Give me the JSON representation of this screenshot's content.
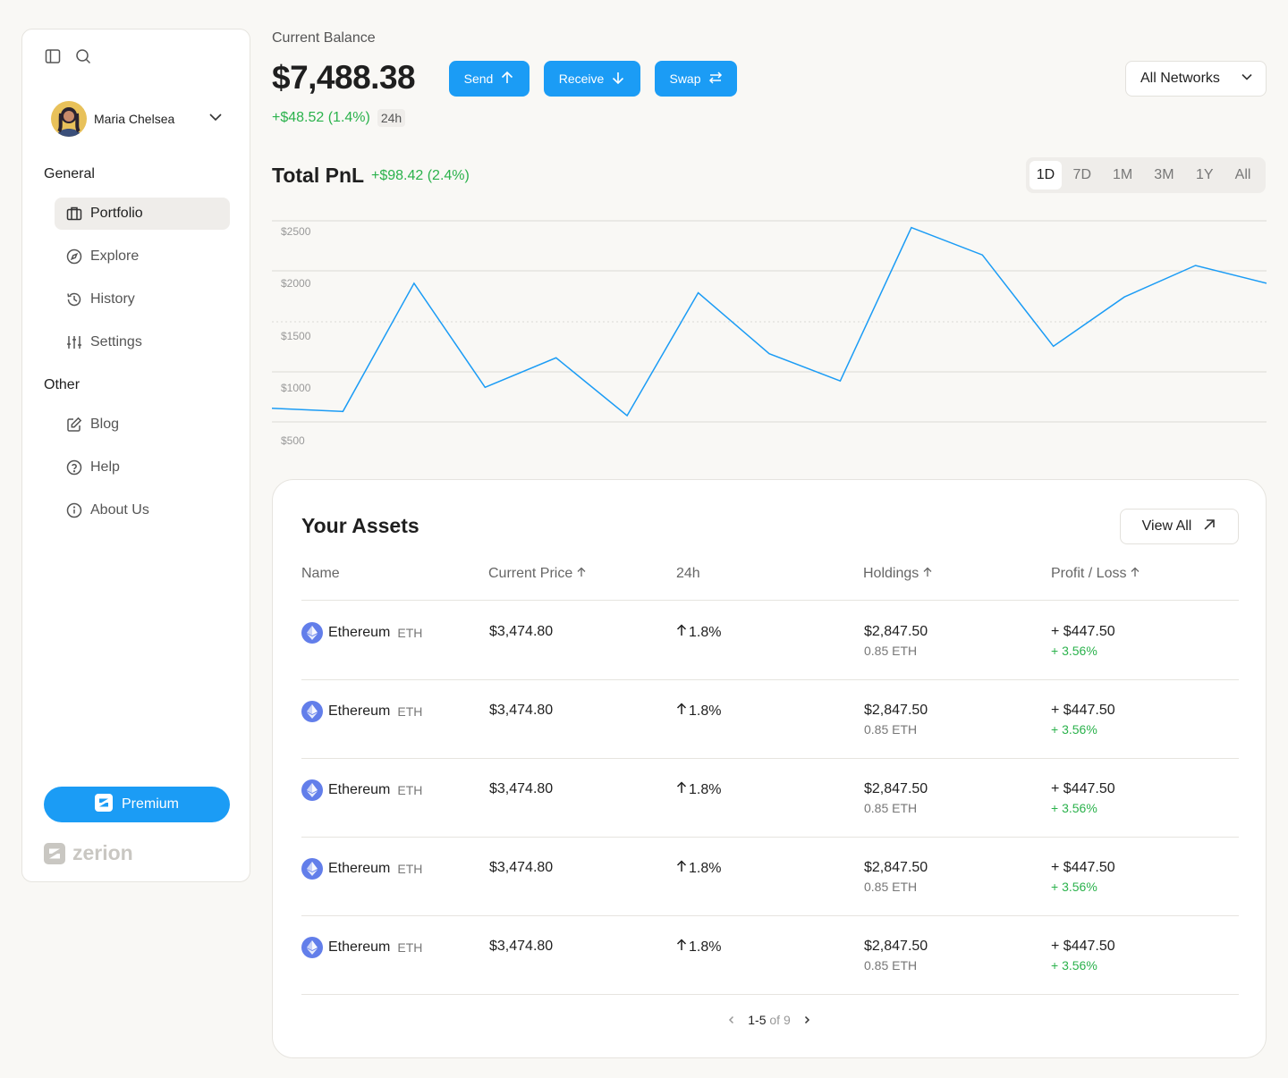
{
  "user": {
    "name": "Maria Chelsea"
  },
  "nav": {
    "general_label": "General",
    "other_label": "Other",
    "general": [
      {
        "label": "Portfolio",
        "icon": "briefcase-icon",
        "active": true
      },
      {
        "label": "Explore",
        "icon": "compass-icon"
      },
      {
        "label": "History",
        "icon": "history-icon"
      },
      {
        "label": "Settings",
        "icon": "sliders-icon"
      }
    ],
    "other": [
      {
        "label": "Blog",
        "icon": "edit-icon"
      },
      {
        "label": "Help",
        "icon": "help-circle-icon"
      },
      {
        "label": "About Us",
        "icon": "info-icon"
      }
    ]
  },
  "premium_label": "Premium",
  "brand": "zerion",
  "balance": {
    "label": "Current Balance",
    "amount": "$7,488.38",
    "change": "+$48.52 (1.4%)",
    "period": "24h"
  },
  "actions": {
    "send": "Send",
    "receive": "Receive",
    "swap": "Swap"
  },
  "network": "All Networks",
  "pnl": {
    "title": "Total PnL",
    "change": "+$98.42 (2.4%)",
    "ranges": [
      "1D",
      "7D",
      "1M",
      "3M",
      "1Y",
      "All"
    ],
    "active_range": "1D"
  },
  "chart_data": {
    "type": "line",
    "y_ticks": [
      "$2500",
      "$2000",
      "$1500",
      "$1000",
      "$500"
    ],
    "ylim": [
      500,
      2500
    ],
    "grid": true,
    "series": [
      {
        "values": [
          800,
          770,
          1990,
          1000,
          1280,
          730,
          1900,
          1320,
          1060,
          2520,
          2260,
          1390,
          1860,
          2160,
          1990
        ]
      }
    ],
    "color": "#1b9cf5"
  },
  "assets": {
    "title": "Your Assets",
    "view_all": "View All",
    "columns": [
      "Name",
      "Current Price",
      "24h",
      "Holdings",
      "Profit / Loss"
    ],
    "rows": [
      {
        "name": "Ethereum",
        "symbol": "ETH",
        "price": "$3,474.80",
        "change": "1.8%",
        "holdings": "$2,847.50",
        "holdings_qty": "0.85 ETH",
        "pl": "+ $447.50",
        "pl_pct": "+ 3.56%"
      },
      {
        "name": "Ethereum",
        "symbol": "ETH",
        "price": "$3,474.80",
        "change": "1.8%",
        "holdings": "$2,847.50",
        "holdings_qty": "0.85 ETH",
        "pl": "+ $447.50",
        "pl_pct": "+ 3.56%"
      },
      {
        "name": "Ethereum",
        "symbol": "ETH",
        "price": "$3,474.80",
        "change": "1.8%",
        "holdings": "$2,847.50",
        "holdings_qty": "0.85 ETH",
        "pl": "+ $447.50",
        "pl_pct": "+ 3.56%"
      },
      {
        "name": "Ethereum",
        "symbol": "ETH",
        "price": "$3,474.80",
        "change": "1.8%",
        "holdings": "$2,847.50",
        "holdings_qty": "0.85 ETH",
        "pl": "+ $447.50",
        "pl_pct": "+ 3.56%"
      },
      {
        "name": "Ethereum",
        "symbol": "ETH",
        "price": "$3,474.80",
        "change": "1.8%",
        "holdings": "$2,847.50",
        "holdings_qty": "0.85 ETH",
        "pl": "+ $447.50",
        "pl_pct": "+ 3.56%"
      }
    ],
    "pagination": {
      "range": "1-5",
      "of": "of 9"
    }
  },
  "colors": {
    "accent": "#1b9cf5",
    "positive": "#2bb24c",
    "background": "#f9f8f5"
  }
}
